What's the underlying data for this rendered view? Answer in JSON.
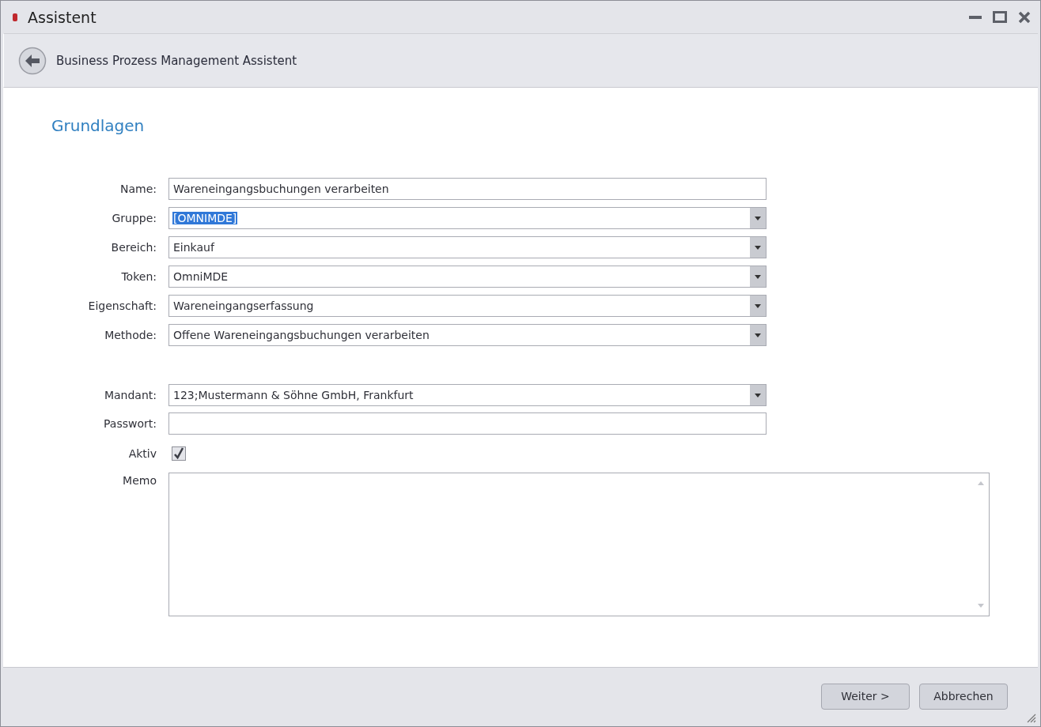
{
  "window": {
    "title": "Assistent"
  },
  "header": {
    "title": "Business Prozess Management Assistent"
  },
  "section_title": "Grundlagen",
  "field_groups": [
    {
      "fields": [
        {
          "kind": "text",
          "label": "Name:",
          "value": "Wareneingangsbuchungen verarbeiten"
        },
        {
          "kind": "combo",
          "label": "Gruppe:",
          "value": "[OMNIMDE]",
          "selected": true
        },
        {
          "kind": "combo",
          "label": "Bereich:",
          "value": "Einkauf",
          "selected": false
        },
        {
          "kind": "combo",
          "label": "Token:",
          "value": "OmniMDE",
          "selected": false
        },
        {
          "kind": "combo",
          "label": "Eigenschaft:",
          "value": "Wareneingangserfassung",
          "selected": false
        },
        {
          "kind": "combo",
          "label": "Methode:",
          "value": "Offene Wareneingangsbuchungen verarbeiten",
          "selected": false
        }
      ]
    },
    {
      "fields": [
        {
          "kind": "combo",
          "label": "Mandant:",
          "value": "123;Mustermann & Söhne GmbH, Frankfurt",
          "selected": false
        },
        {
          "kind": "password",
          "label": "Passwort:"
        },
        {
          "kind": "checkbox",
          "label": "Aktiv",
          "checked": true
        },
        {
          "kind": "memo",
          "label": "Memo"
        }
      ]
    }
  ],
  "buttons": [
    "Weiter >",
    "Abbrechen"
  ]
}
